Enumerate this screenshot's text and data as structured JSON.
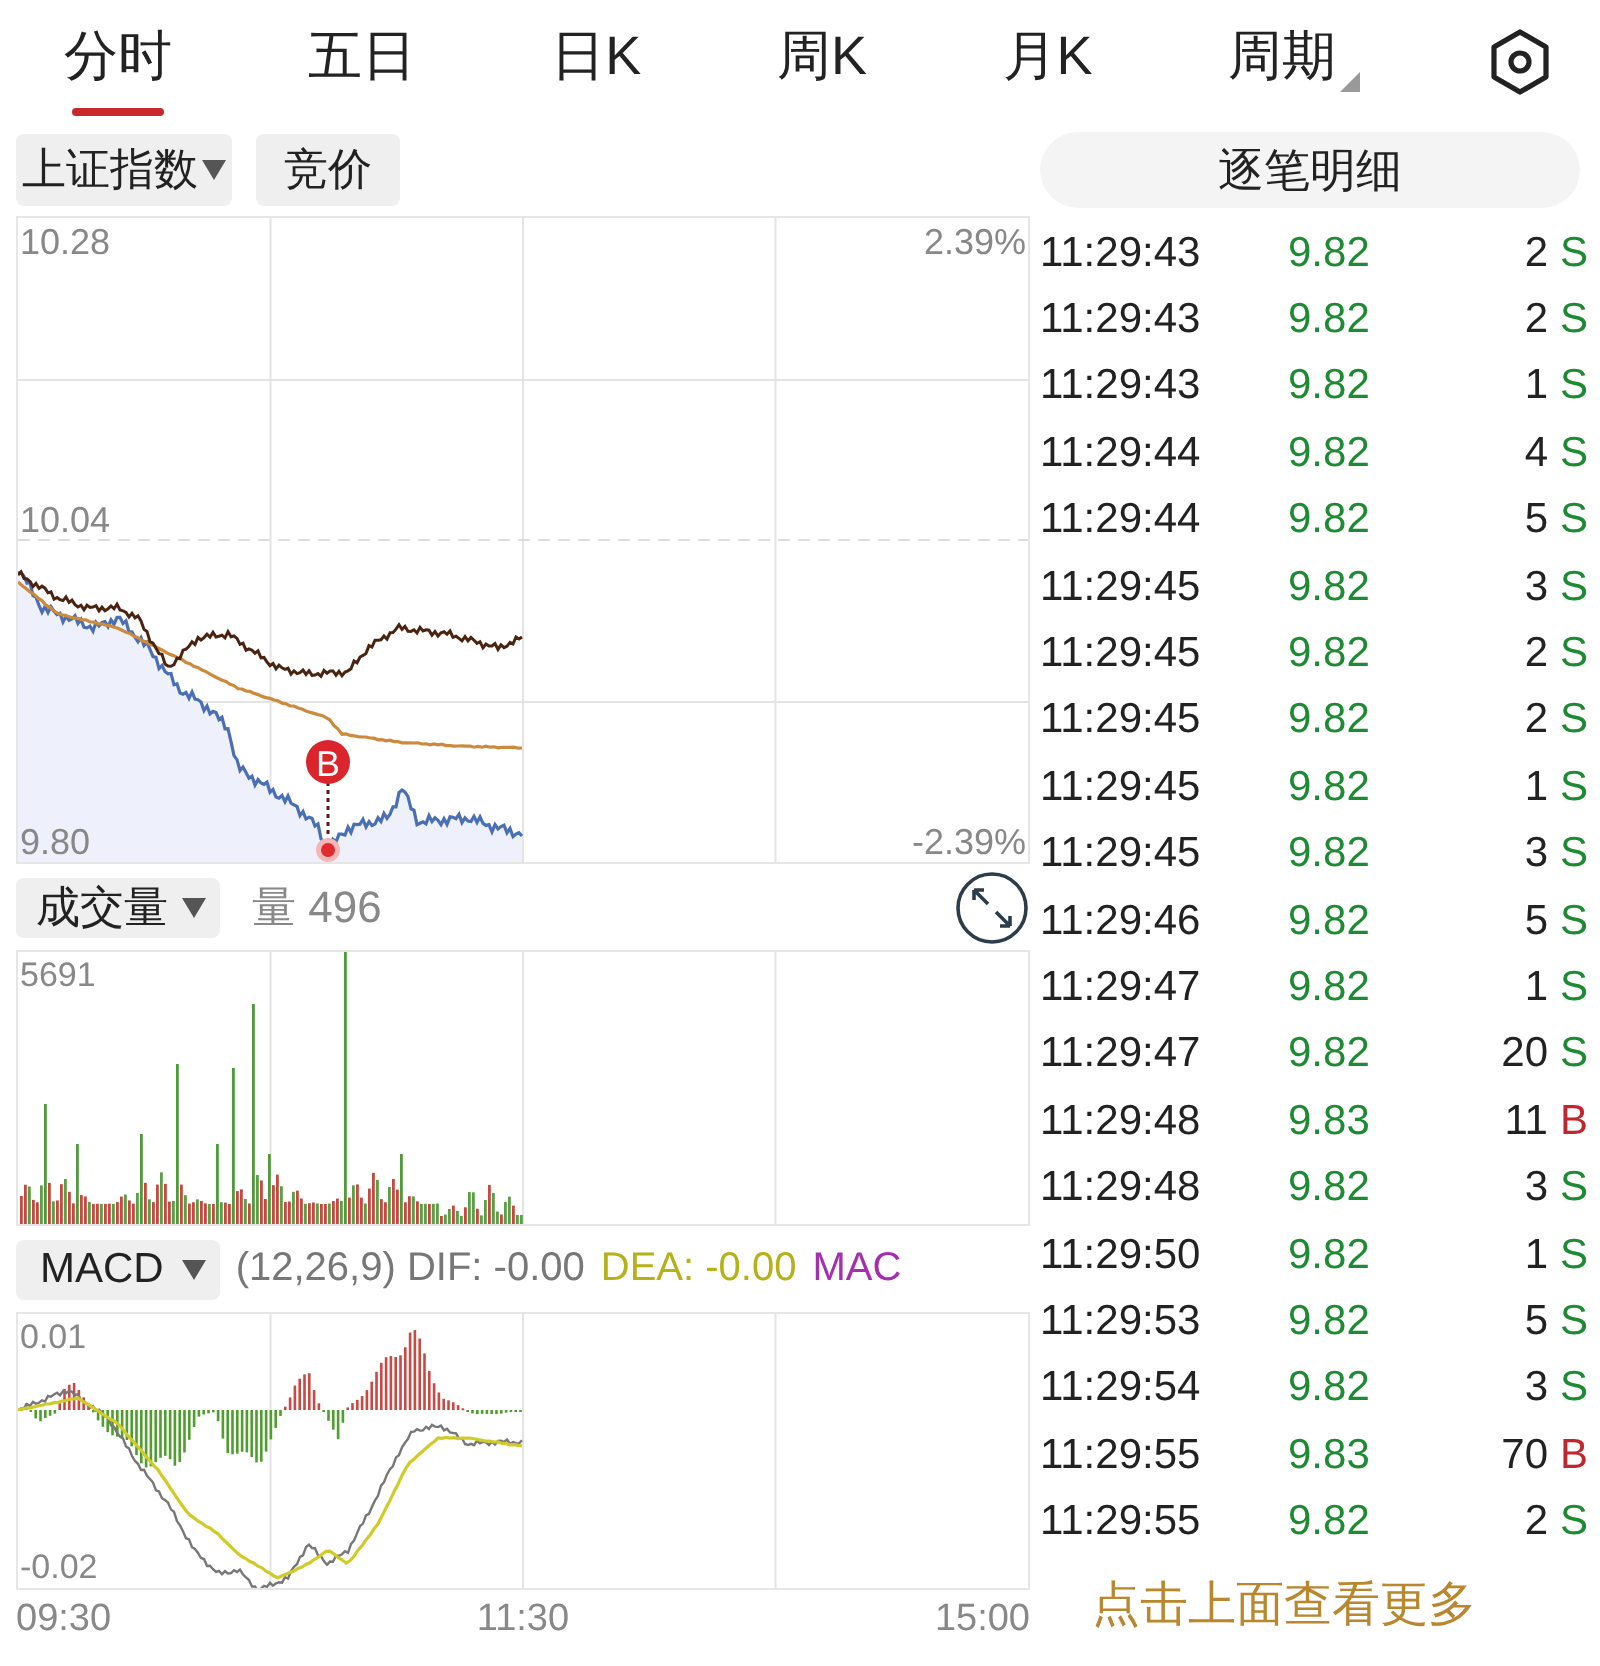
{
  "tabs": [
    {
      "label": "分时",
      "selected": true,
      "kind": "tab"
    },
    {
      "label": "五日",
      "selected": false,
      "kind": "tab"
    },
    {
      "label": "日K",
      "selected": false,
      "kind": "tab"
    },
    {
      "label": "周K",
      "selected": false,
      "kind": "tab"
    },
    {
      "label": "月K",
      "selected": false,
      "kind": "tab"
    },
    {
      "label": "周期",
      "selected": false,
      "kind": "menu"
    }
  ],
  "index_selector": {
    "label": "上证指数"
  },
  "auction_button": {
    "label": "竞价"
  },
  "detail_button": {
    "label": "逐笔明细"
  },
  "price_chart": {
    "left_labels": [
      "10.28",
      "10.04",
      "9.80"
    ],
    "right_labels": [
      "2.39%",
      "-2.39%"
    ],
    "marker": "B"
  },
  "volume": {
    "indicator": "成交量",
    "reading_label": "量",
    "reading": "496",
    "max_label": "5691"
  },
  "macd": {
    "indicator": "MACD",
    "params": "(12,26,9)",
    "dif": "DIF: -0.00",
    "dea": "DEA: -0.00",
    "macd": "MAC",
    "top_label": "0.01",
    "bottom_label": "-0.02"
  },
  "time_axis": [
    "09:30",
    "11:30",
    "15:00"
  ],
  "trades": [
    {
      "time": "11:29:43",
      "price": "9.82",
      "volume": "2",
      "side": "S",
      "kind": "sell"
    },
    {
      "time": "11:29:43",
      "price": "9.82",
      "volume": "2",
      "side": "S",
      "kind": "sell"
    },
    {
      "time": "11:29:43",
      "price": "9.82",
      "volume": "1",
      "side": "S",
      "kind": "sell"
    },
    {
      "time": "11:29:44",
      "price": "9.82",
      "volume": "4",
      "side": "S",
      "kind": "sell"
    },
    {
      "time": "11:29:44",
      "price": "9.82",
      "volume": "5",
      "side": "S",
      "kind": "sell"
    },
    {
      "time": "11:29:45",
      "price": "9.82",
      "volume": "3",
      "side": "S",
      "kind": "sell"
    },
    {
      "time": "11:29:45",
      "price": "9.82",
      "volume": "2",
      "side": "S",
      "kind": "sell"
    },
    {
      "time": "11:29:45",
      "price": "9.82",
      "volume": "2",
      "side": "S",
      "kind": "sell"
    },
    {
      "time": "11:29:45",
      "price": "9.82",
      "volume": "1",
      "side": "S",
      "kind": "sell"
    },
    {
      "time": "11:29:45",
      "price": "9.82",
      "volume": "3",
      "side": "S",
      "kind": "sell"
    },
    {
      "time": "11:29:46",
      "price": "9.82",
      "volume": "5",
      "side": "S",
      "kind": "sell"
    },
    {
      "time": "11:29:47",
      "price": "9.82",
      "volume": "1",
      "side": "S",
      "kind": "sell"
    },
    {
      "time": "11:29:47",
      "price": "9.82",
      "volume": "20",
      "side": "S",
      "kind": "sell"
    },
    {
      "time": "11:29:48",
      "price": "9.83",
      "volume": "11",
      "side": "B",
      "kind": "buy"
    },
    {
      "time": "11:29:48",
      "price": "9.82",
      "volume": "3",
      "side": "S",
      "kind": "sell"
    },
    {
      "time": "11:29:50",
      "price": "9.82",
      "volume": "1",
      "side": "S",
      "kind": "sell"
    },
    {
      "time": "11:29:53",
      "price": "9.82",
      "volume": "5",
      "side": "S",
      "kind": "sell"
    },
    {
      "time": "11:29:54",
      "price": "9.82",
      "volume": "3",
      "side": "S",
      "kind": "sell"
    },
    {
      "time": "11:29:55",
      "price": "9.83",
      "volume": "70",
      "side": "B",
      "kind": "buy"
    },
    {
      "time": "11:29:55",
      "price": "9.82",
      "volume": "2",
      "side": "S",
      "kind": "sell"
    }
  ],
  "more_link": "点击上面查看更多"
}
